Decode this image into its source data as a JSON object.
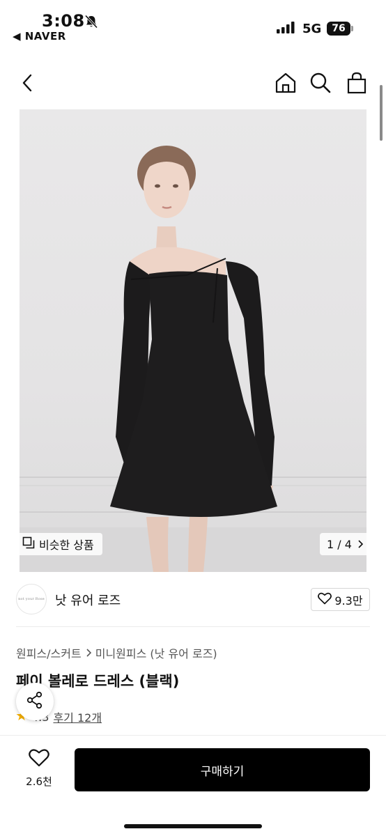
{
  "status_bar": {
    "time": "3:08",
    "back_app": "◀ NAVER",
    "network": "5G",
    "battery": "76"
  },
  "icons": {
    "back": "chevron-left-icon",
    "home": "home-icon",
    "search": "search-icon",
    "bag": "shopping-bag-icon",
    "share": "share-icon",
    "heart": "heart-icon",
    "similar": "copy-icon",
    "star": "star-icon"
  },
  "gallery": {
    "similar_label": "비슷한 상품",
    "page_indicator": "1 / 4"
  },
  "shop": {
    "name": "낫 유어 로즈",
    "logo_text": "not your Rose",
    "follow_count": "9.3만"
  },
  "product": {
    "breadcrumb": [
      "원피스/스커트",
      "미니원피스 (낫 유어 로즈)"
    ],
    "title": "페이 볼레로 드레스 (블랙)",
    "rating": "4.3",
    "reviews": "후기 12개"
  },
  "bottom_bar": {
    "like_count": "2.6천",
    "buy_label": "구매하기"
  },
  "colors": {
    "accent_star": "#f6b000",
    "buy_button": "#000000"
  }
}
